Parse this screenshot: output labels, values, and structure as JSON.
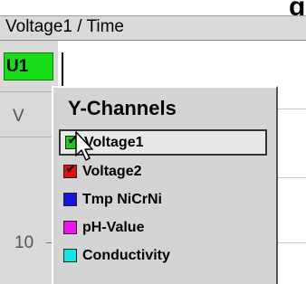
{
  "title_fragment": "g",
  "chart": {
    "title": "Voltage1 / Time"
  },
  "axis": {
    "channel_button": "U1",
    "unit": "V",
    "tick_label": "10"
  },
  "popup": {
    "title": "Y-Channels",
    "items": [
      {
        "label": "Voltage1",
        "color": "#18cc18",
        "checked": true,
        "selected": true
      },
      {
        "label": "Voltage2",
        "color": "#e01010",
        "checked": true,
        "selected": false
      },
      {
        "label": "Tmp NiCrNi",
        "color": "#1414e0",
        "checked": false,
        "selected": false
      },
      {
        "label": "pH-Value",
        "color": "#f010f0",
        "checked": false,
        "selected": false
      },
      {
        "label": "Conductivity",
        "color": "#10e8e8",
        "checked": false,
        "selected": false
      }
    ]
  }
}
